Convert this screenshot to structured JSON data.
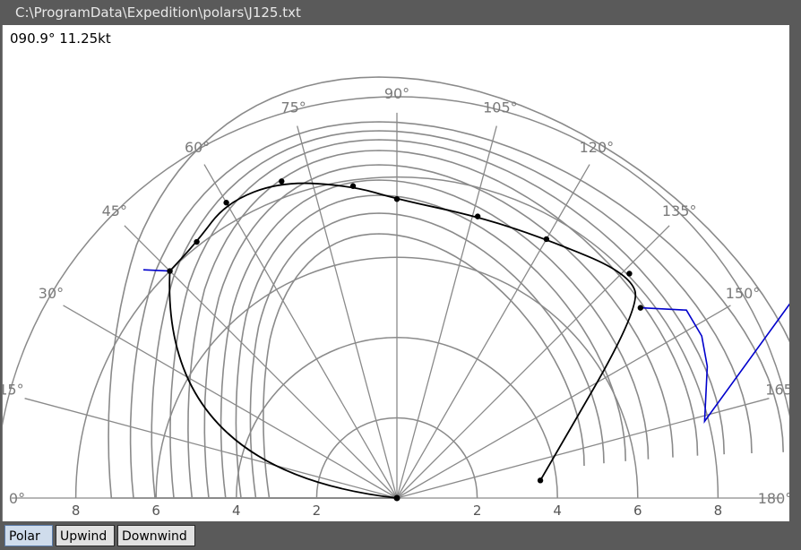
{
  "window": {
    "title": "C:\\ProgramData\\Expedition\\polars\\J125.txt"
  },
  "readout": "090.9° 11.25kt",
  "tabs": [
    {
      "label": "Polar",
      "active": true
    },
    {
      "label": "Upwind",
      "active": false
    },
    {
      "label": "Downwind",
      "active": false
    }
  ],
  "colors": {
    "grid": "#8a8a8a",
    "current_curve": "#000000",
    "optimal_line": "#0000cc"
  },
  "chart_data": {
    "type": "polar",
    "angle_labels": [
      "0°",
      "15°",
      "30°",
      "45°",
      "60°",
      "75°",
      "90°",
      "105°",
      "120°",
      "135°",
      "150°",
      "165°",
      "180°"
    ],
    "speed_ticks_left": [
      "8",
      "6",
      "4",
      "2"
    ],
    "speed_ticks_right": [
      "2",
      "4",
      "6",
      "8"
    ],
    "speed_rings_kt": [
      2,
      4,
      6,
      8
    ],
    "current_curve": {
      "points": [
        {
          "twa": 45,
          "speed": 8.0
        },
        {
          "twa": 52,
          "speed": 8.1
        },
        {
          "twa": 60,
          "speed": 8.5
        },
        {
          "twa": 70,
          "speed": 8.4
        },
        {
          "twa": 82,
          "speed": 7.85
        },
        {
          "twa": 90,
          "speed": 7.45
        },
        {
          "twa": 106,
          "speed": 7.3
        },
        {
          "twa": 120,
          "speed": 7.45
        },
        {
          "twa": 136,
          "speed": 8.05
        },
        {
          "twa": 142,
          "speed": 7.7
        },
        {
          "twa": 173,
          "speed": 3.6
        }
      ]
    },
    "optimal_line": {
      "points": [
        {
          "twa": 42,
          "speed": 8.5
        },
        {
          "twa": 45,
          "speed": 8.0
        },
        {
          "twa": 142,
          "speed": 7.7
        },
        {
          "twa": 147,
          "speed": 8.6
        },
        {
          "twa": 152,
          "speed": 8.6
        },
        {
          "twa": 157,
          "speed": 8.4
        },
        {
          "twa": 166,
          "speed": 7.9
        },
        {
          "twa": 151,
          "speed": 12.0
        },
        {
          "twa": 140,
          "speed": 14.6
        }
      ]
    },
    "other_curves_count": 10
  }
}
